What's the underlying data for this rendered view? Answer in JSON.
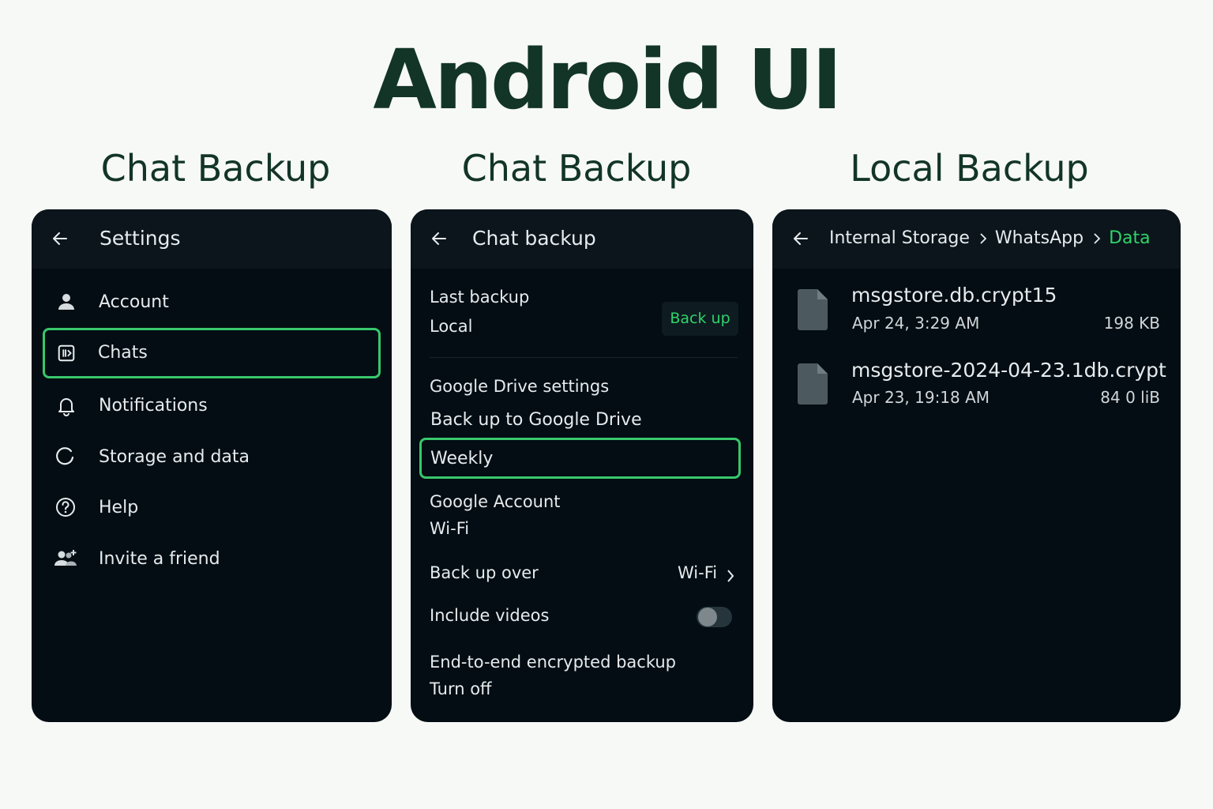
{
  "page_title": "Android UI",
  "panels": [
    {
      "title": "Chat Backup"
    },
    {
      "title": "Chat Backup"
    },
    {
      "title": "Local Backup"
    }
  ],
  "settings": {
    "title": "Settings",
    "items": [
      {
        "label": "Account",
        "icon": "person-icon"
      },
      {
        "label": "Chats",
        "icon": "chat-icon",
        "selected": true
      },
      {
        "label": "Notifications",
        "icon": "bell-icon"
      },
      {
        "label": "Storage and data",
        "icon": "refresh-icon"
      },
      {
        "label": "Help",
        "icon": "help-icon"
      },
      {
        "label": "Invite a friend",
        "icon": "add-people-icon"
      }
    ]
  },
  "chat_backup": {
    "title": "Chat backup",
    "last_backup_label": "Last backup",
    "last_backup_value": "Local",
    "back_up_button": "Back up",
    "gdrive_settings": "Google Drive settings",
    "backup_to_gdrive": "Back up to Google Drive",
    "frequency": "Weekly",
    "google_account_label": "Google Account",
    "google_account_value": "Wi-Fi",
    "backup_over_label": "Back up over",
    "backup_over_value": "Wi-Fi",
    "include_videos_label": "Include videos",
    "include_videos_on": false,
    "e2e_label": "End-to-end encrypted backup",
    "e2e_value": "Turn off"
  },
  "local_backup": {
    "breadcrumb": [
      "Internal Storage",
      "WhatsApp",
      "Data"
    ],
    "files": [
      {
        "name": "msgstore.db.crypt15",
        "date": "Apr 24, 3:29 AM",
        "size": "198 KB"
      },
      {
        "name": "msgstore-2024-04-23.1db.crypt",
        "date": "Apr 23, 19:18 AM",
        "size": "84 0 liB"
      }
    ]
  },
  "colors": {
    "accent": "#38c76b",
    "background": "#030d13",
    "appbar": "#0b151b",
    "title_text": "#123528"
  }
}
